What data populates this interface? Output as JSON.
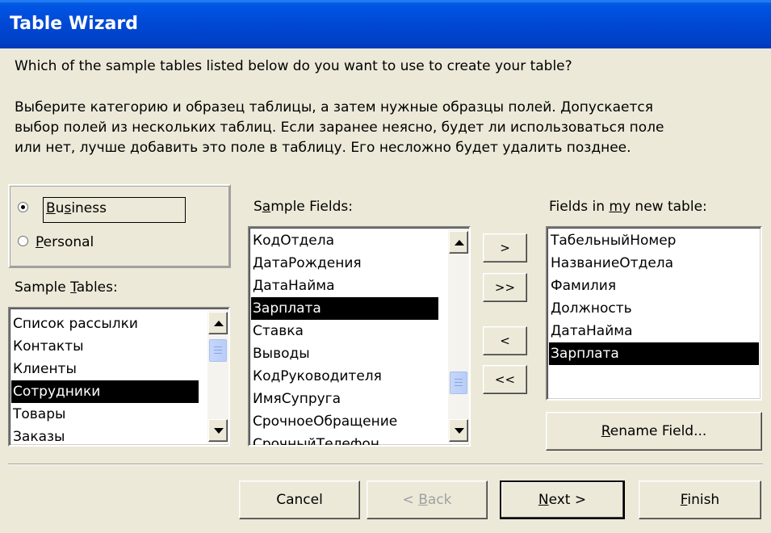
{
  "window": {
    "title": "Table Wizard"
  },
  "question": "Which of the sample tables listed below do you want to use to create your table?",
  "instructions": [
    "Выберите категорию и образец таблицы, а затем нужные образцы полей. Допускается",
    "выбор полей из нескольких таблиц. Если заранее неясно, будет ли использоваться поле",
    "или нет, лучше добавить это поле в таблицу. Его несложно будет удалить позднее."
  ],
  "category": {
    "options": [
      "Business",
      "Personal"
    ],
    "selected": "Business"
  },
  "sample_tables": {
    "label": "Sample Tables:",
    "items": [
      "Список рассылки",
      "Контакты",
      "Клиенты",
      "Сотрудники",
      "Товары",
      "Заказы"
    ],
    "selected": "Сотрудники"
  },
  "sample_fields": {
    "label": "Sample Fields:",
    "items": [
      "КодОтдела",
      "ДатаРождения",
      "ДатаНайма",
      "Зарплата",
      "Ставка",
      "Выводы",
      "КодРуководителя",
      "ИмяСупруга",
      "СрочноеОбращение",
      "СрочныйТелефон"
    ],
    "selected": "Зарплата"
  },
  "transfer_buttons": {
    "add": ">",
    "add_all": ">>",
    "remove": "<",
    "remove_all": "<<"
  },
  "new_table_fields": {
    "label": "Fields in my new table:",
    "items": [
      "ТабельныйНомер",
      "НазваниеОтдела",
      "Фамилия",
      "Должность",
      "ДатаНайма",
      "Зарплата"
    ],
    "selected": "Зарплата"
  },
  "rename_button": "Rename Field...",
  "footer": {
    "cancel": "Cancel",
    "back": "< Back",
    "next": "Next >",
    "finish": "Finish"
  },
  "colors": {
    "titlebar": "#0049d4",
    "face": "#ece9d8",
    "selection": "#000000"
  }
}
